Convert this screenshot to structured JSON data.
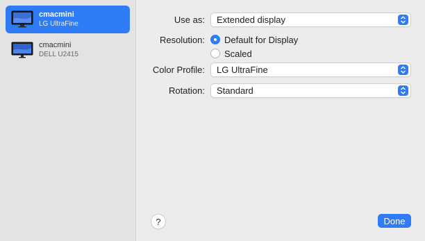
{
  "sidebar": {
    "items": [
      {
        "name": "cmacmini",
        "model": "LG UltraFine",
        "selected": true
      },
      {
        "name": "cmacmini",
        "model": "DELL U2415",
        "selected": false
      }
    ]
  },
  "settings": {
    "use_as": {
      "label": "Use as:",
      "value": "Extended display"
    },
    "resolution": {
      "label": "Resolution:",
      "options": [
        {
          "label": "Default for Display",
          "selected": true
        },
        {
          "label": "Scaled",
          "selected": false
        }
      ]
    },
    "color_profile": {
      "label": "Color Profile:",
      "value": "LG UltraFine"
    },
    "rotation": {
      "label": "Rotation:",
      "value": "Standard"
    }
  },
  "footer": {
    "help_label": "?",
    "done_label": "Done"
  },
  "colors": {
    "accent": "#2f7cf6"
  },
  "icons": {
    "display": "monitor-icon",
    "popup": "chevron-updown-icon"
  }
}
